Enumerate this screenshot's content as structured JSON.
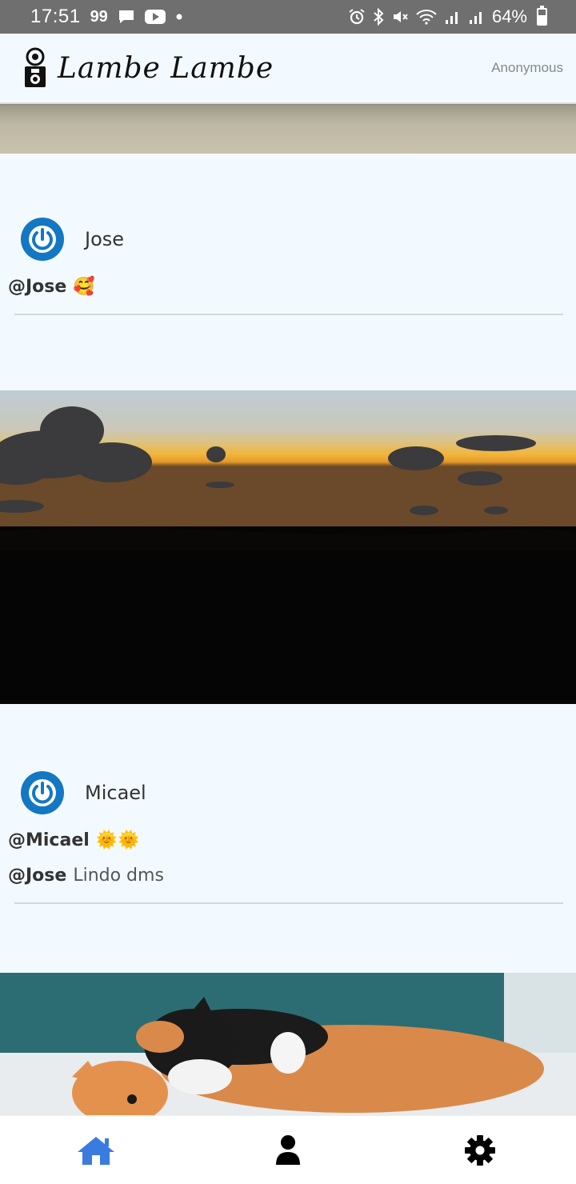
{
  "status_bar": {
    "time": "17:51",
    "notification_text": "99",
    "battery": "64%",
    "icons": [
      "message-icon",
      "youtube-icon",
      "dot-icon",
      "alarm-icon",
      "bluetooth-icon",
      "mute-icon",
      "wifi-icon",
      "signal-icon",
      "signal-icon",
      "battery-icon"
    ]
  },
  "header": {
    "title": "Lambe Lambe",
    "user": "Anonymous",
    "logo_icon": "camera-icon"
  },
  "posts": [
    {
      "author": "Jose",
      "avatar_icon": "power-icon",
      "comments": [
        {
          "handle": "@Jose",
          "text": "",
          "emoji": "🥰"
        }
      ]
    },
    {
      "author": "Micael",
      "avatar_icon": "power-icon",
      "comments": [
        {
          "handle": "@Micael",
          "text": "",
          "emoji": "🌞🌞"
        },
        {
          "handle": "@Jose",
          "text": "Lindo dms",
          "emoji": ""
        }
      ]
    }
  ],
  "nav": {
    "items": [
      {
        "icon": "home-icon",
        "active": true
      },
      {
        "icon": "user-icon",
        "active": false
      },
      {
        "icon": "settings-icon",
        "active": false
      }
    ]
  },
  "colors": {
    "accent": "#1377c3",
    "nav_active": "#3a7be0",
    "background": "#f3faff"
  }
}
